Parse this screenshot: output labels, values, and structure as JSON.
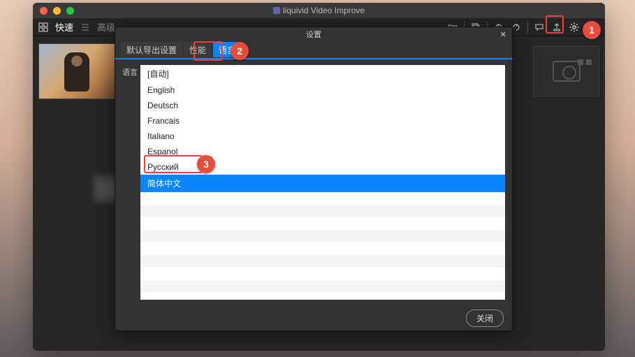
{
  "window": {
    "title": "liquivid Video Improve"
  },
  "toolbar": {
    "mode_quick": "快速",
    "mode_advanced": "高级"
  },
  "dialog": {
    "title": "设置",
    "tabs": {
      "export": "默认导出设置",
      "performance": "性能",
      "language": "语言"
    },
    "sidelabel": "语言",
    "languages": [
      {
        "label": "[自动]",
        "selected": false
      },
      {
        "label": "English",
        "selected": false
      },
      {
        "label": "Deutsch",
        "selected": false
      },
      {
        "label": "Francais",
        "selected": false
      },
      {
        "label": "Italiano",
        "selected": false
      },
      {
        "label": "Espanol",
        "selected": false
      },
      {
        "label": "Русский",
        "selected": false
      },
      {
        "label": "简体中文",
        "selected": true
      }
    ],
    "close_label": "关闭"
  },
  "annotations": {
    "n1": "1",
    "n2": "2",
    "n3": "3"
  }
}
